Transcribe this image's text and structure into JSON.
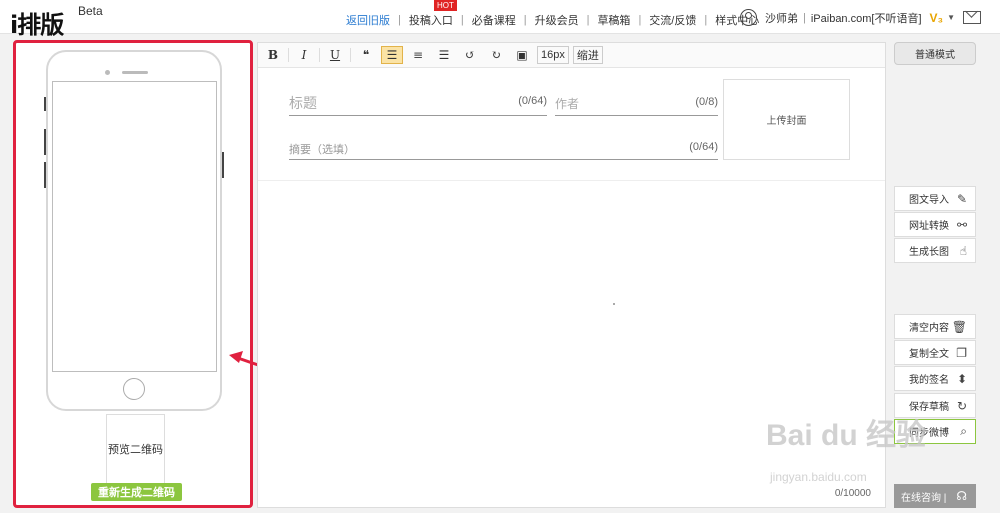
{
  "logo": {
    "text": "i排版",
    "badge": "Beta"
  },
  "nav": {
    "items": [
      "返回旧版",
      "投稿入口",
      "必备课程",
      "升级会员",
      "草稿箱",
      "交流/反馈",
      "样式中心"
    ],
    "hot": "HOT"
  },
  "user": {
    "name": "沙师弟",
    "site": "iPaiban.com[不听语音]",
    "vip": "V₃"
  },
  "preview": {
    "qr": "预览二维码",
    "regen": "重新生成二维码"
  },
  "toolbar": {
    "bold": "B",
    "italic": "I",
    "underline": "U",
    "quote": "❝",
    "font_size": "16px",
    "indent": "缩进"
  },
  "editor": {
    "title_placeholder": "标题",
    "title_count": "(0/64)",
    "author_placeholder": "作者",
    "author_count": "(0/8)",
    "summary_placeholder": "摘要（选填）",
    "summary_count": "(0/64)",
    "cover": "上传封面",
    "word_count": "0/10000"
  },
  "side": {
    "mode": "普通模式",
    "import": "图文导入",
    "url": "网址转换",
    "longimg": "生成长图",
    "clear": "清空内容",
    "copy": "复制全文",
    "sign": "我的签名",
    "save": "保存草稿",
    "weibo": "同步微博",
    "consult": "在线咨询 |"
  },
  "watermark": {
    "main": "Bai du 经验",
    "sub": "jingyan.baidu.com"
  }
}
